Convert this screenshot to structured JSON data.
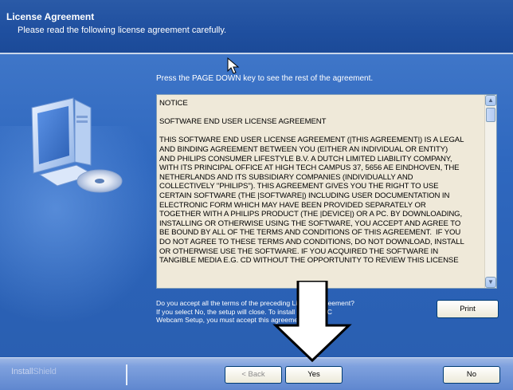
{
  "header": {
    "title": "License Agreement",
    "subtitle": "Please read the following license agreement carefully."
  },
  "instruction": "Press the PAGE DOWN key to see the rest of the agreement.",
  "license": {
    "text": "NOTICE\n\nSOFTWARE END USER LICENSE AGREEMENT\n\nTHIS SOFTWARE END USER LICENSE AGREEMENT (|THIS AGREEMENT|) IS A LEGAL\nAND BINDING AGREEMENT BETWEEN YOU (EITHER AN INDIVIDUAL OR ENTITY)\nAND PHILIPS CONSUMER LIFESTYLE B.V. A DUTCH LIMITED LIABILITY COMPANY,\nWITH ITS PRINCIPAL OFFICE AT HIGH TECH CAMPUS 37, 5656 AE EINDHOVEN, THE\nNETHERLANDS AND ITS SUBSIDIARY COMPANIES (INDIVIDUALLY AND\nCOLLECTIVELY \"PHILIPS\"). THIS AGREEMENT GIVES YOU THE RIGHT TO USE\nCERTAIN SOFTWARE (THE |SOFTWARE|) INCLUDING USER DOCUMENTATION IN\nELECTRONIC FORM WHICH MAY HAVE BEEN PROVIDED SEPARATELY OR\nTOGETHER WITH A PHILIPS PRODUCT (THE |DEVICE|) OR A PC. BY DOWNLOADING,\nINSTALLING OR OTHERWISE USING THE SOFTWARE, YOU ACCEPT AND AGREE TO\nBE BOUND BY ALL OF THE TERMS AND CONDITIONS OF THIS AGREEMENT.  IF YOU\nDO NOT AGREE TO THESE TERMS AND CONDITIONS, DO NOT DOWNLOAD, INSTALL\nOR OTHERWISE USE THE SOFTWARE. IF YOU ACQUIRED THE SOFTWARE IN\nTANGIBLE MEDIA E.G. CD WITHOUT THE OPPORTUNITY TO REVIEW THIS LICENSE"
  },
  "question": "Do you accept all the terms of the preceding License Agreement?  If you select No,  the setup will close.  To install SPC640NC Webcam Setup, you must accept this agreement.",
  "buttons": {
    "print": "Print",
    "back": "< Back",
    "yes": "Yes",
    "no": "No"
  },
  "brand": {
    "install": "Install",
    "shield": "Shield"
  },
  "colors": {
    "header_blue": "#1f4f9f",
    "body_blue": "#2f68bf",
    "license_bg": "#efe9d9"
  }
}
